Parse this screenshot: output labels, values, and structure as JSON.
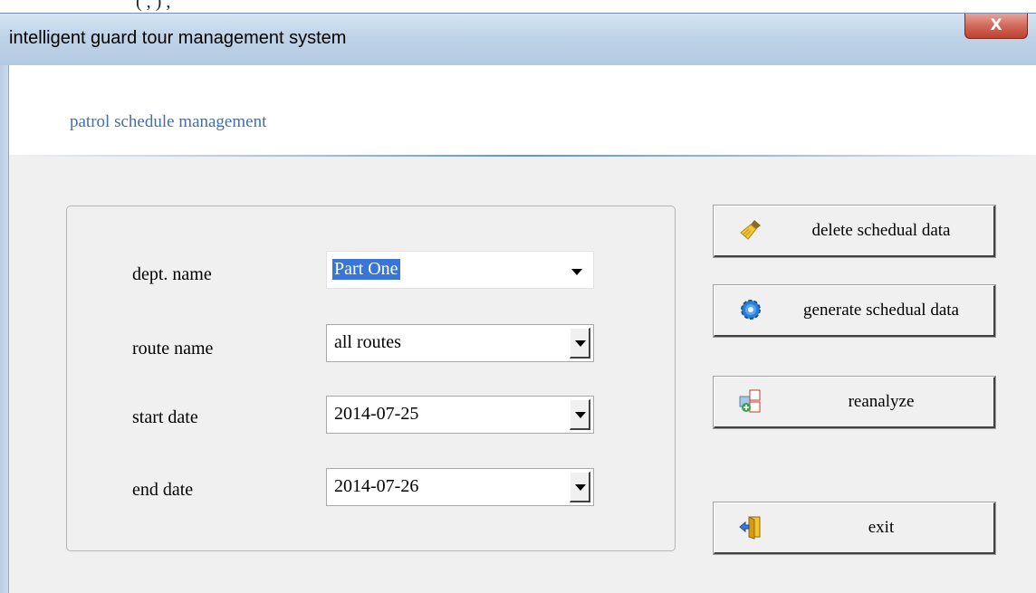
{
  "top_strip_text": "(    ,    )           ,",
  "window": {
    "title": "intelligent guard tour management system",
    "close_label": "X"
  },
  "header": {
    "subtitle": "patrol schedule management"
  },
  "form": {
    "dept": {
      "label": "dept. name",
      "value": "Part One"
    },
    "route": {
      "label": "route name",
      "value": "all routes"
    },
    "start": {
      "label": "start date",
      "value": "2014-07-25"
    },
    "end": {
      "label": "end date",
      "value": "2014-07-26"
    }
  },
  "actions": {
    "delete": {
      "label": "delete schedual data",
      "icon": "broom-icon"
    },
    "generate": {
      "label": "generate schedual data",
      "icon": "gear-icon"
    },
    "reanalyze": {
      "label": "reanalyze",
      "icon": "reanalyze-icon"
    },
    "exit": {
      "label": "exit",
      "icon": "exit-door-icon"
    }
  },
  "colors": {
    "titlebar": "#bfd3e8",
    "close": "#c8493a",
    "subtitle": "#3f6fb0",
    "selection": "#3875d7"
  }
}
